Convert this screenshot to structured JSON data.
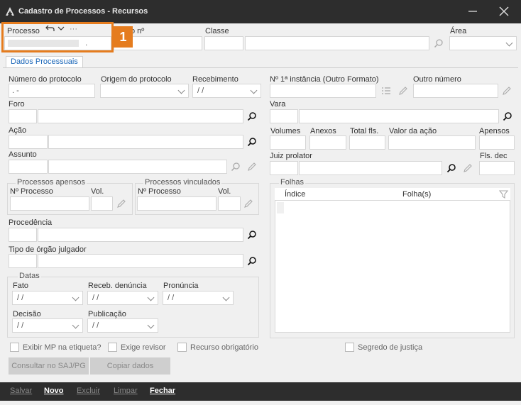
{
  "window": {
    "title": "Cadastro de Processos - Recursos"
  },
  "top": {
    "processo_label": "Processo",
    "processo_value": "",
    "processo_suffix": ".",
    "numero_label": "o nº",
    "classe_label": "Classe",
    "area_label": "Área",
    "badge": "1"
  },
  "tabs": [
    {
      "label": "Dados Processuais"
    }
  ],
  "left": {
    "num_protocolo_label": "Número do protocolo",
    "num_protocolo_value": ".       -",
    "origem_label": "Origem do protocolo",
    "recebimento_label": "Recebimento",
    "recebimento_value": "/ /",
    "foro_label": "Foro",
    "acao_label": "Ação",
    "assunto_label": "Assunto",
    "apensos_group": "Processos apensos",
    "vinculados_group": "Processos vinculados",
    "nprocesso_label": "Nº Processo",
    "vol_label": "Vol.",
    "procedencia_label": "Procedência",
    "tipo_orgao_label": "Tipo de órgão julgador",
    "datas_group": "Datas",
    "fato_label": "Fato",
    "receb_denuncia_label": "Receb. denúncia",
    "pronuncia_label": "Pronúncia",
    "decisao_label": "Decisão",
    "publicacao_label": "Publicação",
    "date_placeholder": "/ /"
  },
  "right": {
    "primeira_instancia_label": "Nº 1ª instância (Outro Formato)",
    "outro_numero_label": "Outro número",
    "vara_label": "Vara",
    "volumes_label": "Volumes",
    "anexos_label": "Anexos",
    "total_fls_label": "Total fls.",
    "valor_acao_label": "Valor da ação",
    "apensos_label": "Apensos",
    "juiz_label": "Juiz prolator",
    "fls_dec_label": "Fls. dec",
    "folhas_group": "Folhas",
    "indice_col": "Índice",
    "folhas_col": "Folha(s)"
  },
  "checks": {
    "exibir_mp": "Exibir MP na etiqueta?",
    "exige_revisor": "Exige revisor",
    "recurso_obrigatorio": "Recurso obrigatório",
    "segredo_justica": "Segredo de justiça"
  },
  "buttons": {
    "consultar_saj": "Consultar no SAJ/PG",
    "copiar_dados": "Copiar dados"
  },
  "bottom": {
    "salvar": "Salvar",
    "novo": "Novo",
    "excluir": "Excluir",
    "limpar": "Limpar",
    "fechar": "Fechar"
  },
  "colors": {
    "accent": "#e57c1e",
    "titlebar": "#2d2d2d",
    "tab_text": "#1a66b8"
  }
}
